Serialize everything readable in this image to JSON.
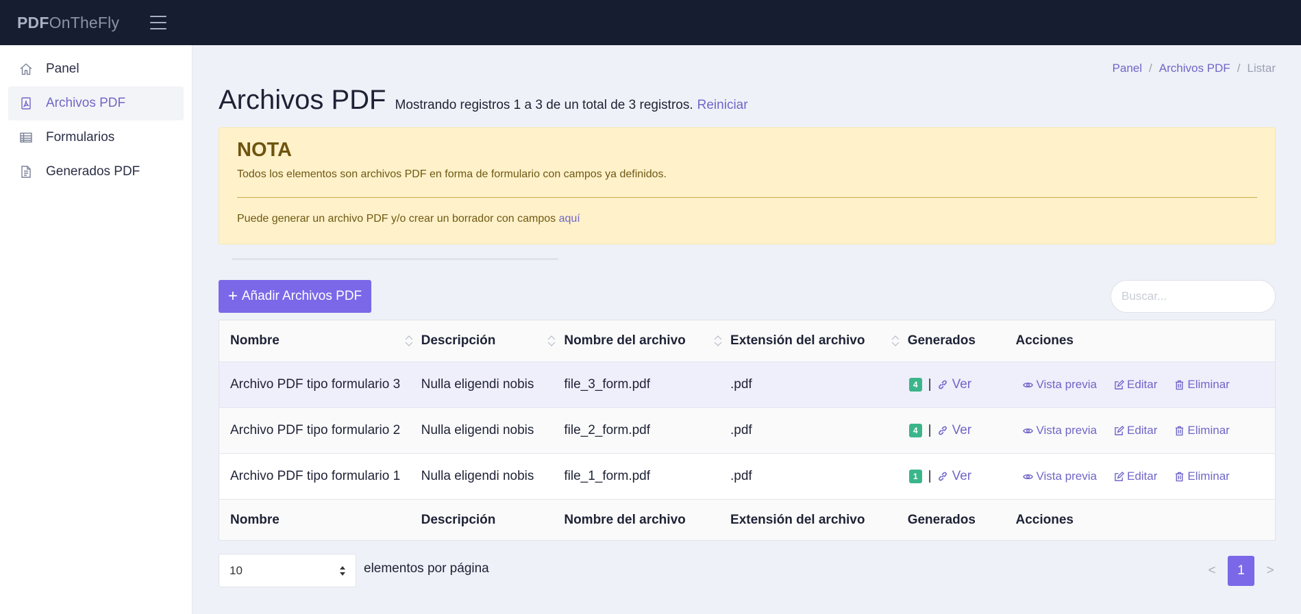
{
  "app": {
    "brand_bold": "PDF",
    "brand_rest": "OnTheFly"
  },
  "sidebar": {
    "items": [
      {
        "label": "Panel",
        "icon": "home-icon",
        "active": false
      },
      {
        "label": "Archivos PDF",
        "icon": "pdf-file-icon",
        "active": true
      },
      {
        "label": "Formularios",
        "icon": "table-icon",
        "active": false
      },
      {
        "label": "Generados PDF",
        "icon": "document-icon",
        "active": false
      }
    ]
  },
  "breadcrumb": {
    "items": [
      "Panel",
      "Archivos PDF"
    ],
    "current": "Listar",
    "separator": "/"
  },
  "header": {
    "title": "Archivos PDF",
    "subtitle": "Mostrando registros 1 a 3 de un total de 3 registros.",
    "reset_label": "Reiniciar"
  },
  "note": {
    "title": "NOTA",
    "line1": "Todos los elementos son archivos PDF en forma de formulario con campos ya definidos.",
    "line2": "Puede generar un archivo PDF y/o crear un borrador con campos",
    "link": "aquí"
  },
  "toolbar": {
    "add_label": "Añadir Archivos PDF",
    "search_placeholder": "Buscar..."
  },
  "table": {
    "columns": [
      "Nombre",
      "Descripción",
      "Nombre del archivo",
      "Extensión del archivo",
      "Generados",
      "Acciones"
    ],
    "rows": [
      {
        "name": "Archivo PDF tipo formulario 3",
        "description": "Nulla eligendi nobis",
        "file": "file_3_form.pdf",
        "ext": ".pdf",
        "generated": "4"
      },
      {
        "name": "Archivo PDF tipo formulario 2",
        "description": "Nulla eligendi nobis",
        "file": "file_2_form.pdf",
        "ext": ".pdf",
        "generated": "4"
      },
      {
        "name": "Archivo PDF tipo formulario 1",
        "description": "Nulla eligendi nobis",
        "file": "file_1_form.pdf",
        "ext": ".pdf",
        "generated": "1"
      }
    ],
    "view_label": "Ver",
    "actions": {
      "preview": "Vista previa",
      "edit": "Editar",
      "delete": "Eliminar"
    }
  },
  "pagination": {
    "per_page_value": "10",
    "per_page_label": "elementos por página",
    "prev": "<",
    "current": "1",
    "next": ">"
  },
  "colors": {
    "accent": "#7b68e8",
    "link": "#6f66c8",
    "topbar": "#171d30",
    "alert_bg": "#fff1c9",
    "badge": "#3bb58a"
  }
}
